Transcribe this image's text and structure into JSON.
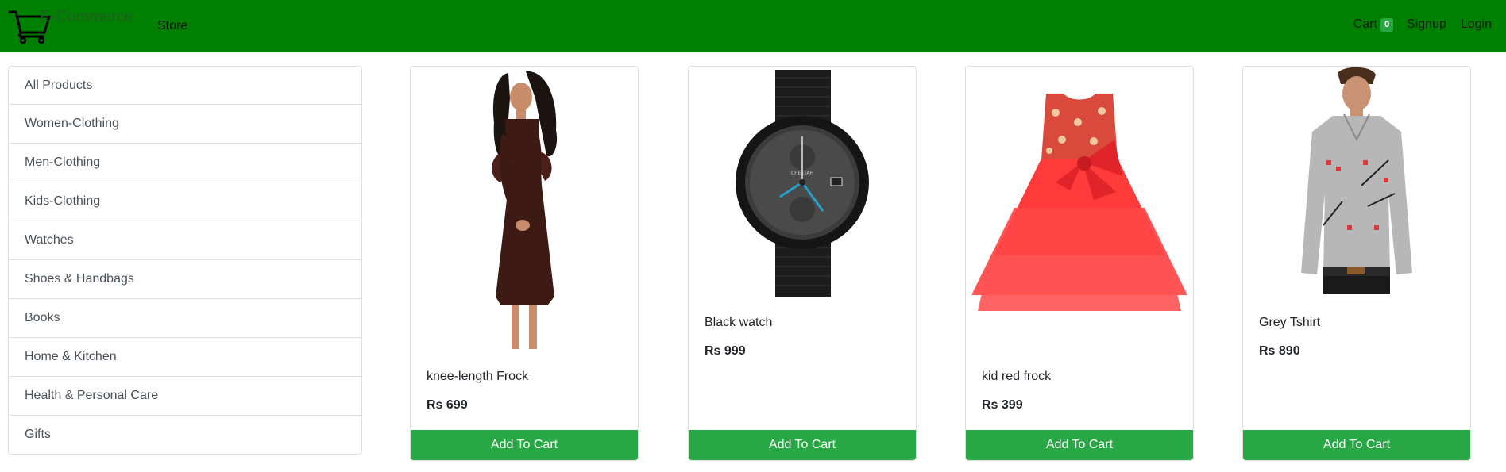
{
  "navbar": {
    "brand": "E-Commerce",
    "store_label": "Store",
    "cart_label": "Cart",
    "cart_count": "0",
    "signup_label": "Signup",
    "login_label": "Login",
    "colors": {
      "navbar_bg": "#008000",
      "accent": "#28a745"
    }
  },
  "sidebar": {
    "categories": [
      "All Products",
      "Women-Clothing",
      "Men-Clothing",
      "Kids-Clothing",
      "Watches",
      "Shoes & Handbags",
      "Books",
      "Home & Kitchen",
      "Health & Personal Care",
      "Gifts"
    ]
  },
  "products": [
    {
      "title": "knee-length Frock",
      "price": "Rs 699",
      "image": "brown-dress-image",
      "button": "Add To Cart"
    },
    {
      "title": "Black watch",
      "price": "Rs 999",
      "image": "black-watch-image",
      "button": "Add To Cart"
    },
    {
      "title": "kid red frock",
      "price": "Rs 399",
      "image": "red-frock-image",
      "button": "Add To Cart"
    },
    {
      "title": "Grey Tshirt",
      "price": "Rs 890",
      "image": "grey-tshirt-image",
      "button": "Add To Cart"
    }
  ]
}
